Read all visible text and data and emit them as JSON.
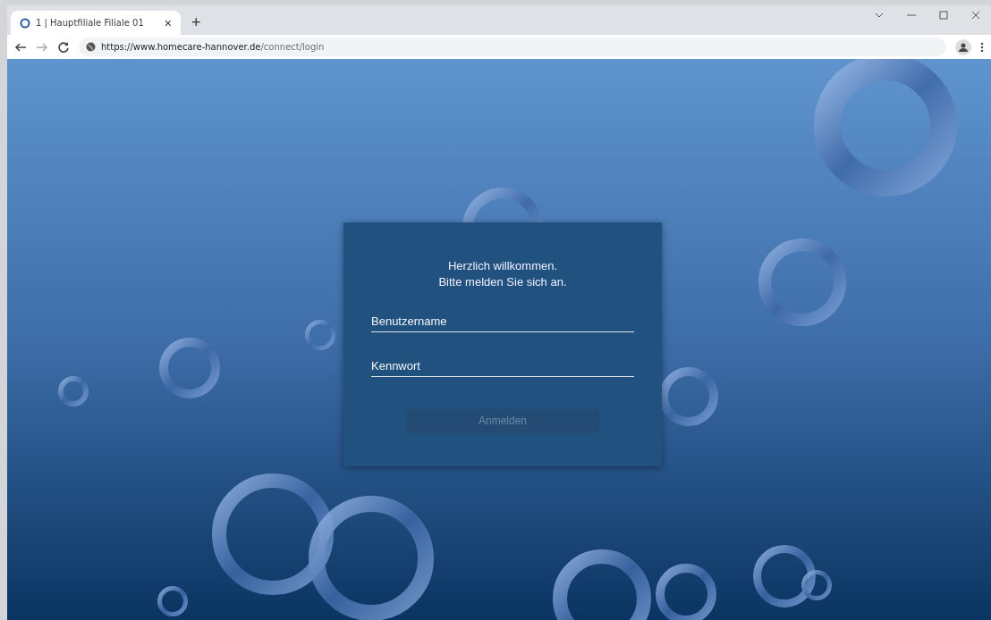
{
  "browser": {
    "tab": {
      "title": "1 | Hauptfiliale Filiale 01",
      "close": "×",
      "selected": true
    },
    "new_tab": "+",
    "url": {
      "host": "https://www.homecare-hannover.de",
      "path": "/connect/login"
    }
  },
  "login": {
    "greeting": "Herzlich willkommen.",
    "instruction": "Bitte melden Sie sich an.",
    "fields": [
      {
        "placeholder": "Benutzername"
      },
      {
        "placeholder": "Kennwort"
      }
    ],
    "submit": {
      "label": "Anmelden",
      "disabled": true
    }
  }
}
